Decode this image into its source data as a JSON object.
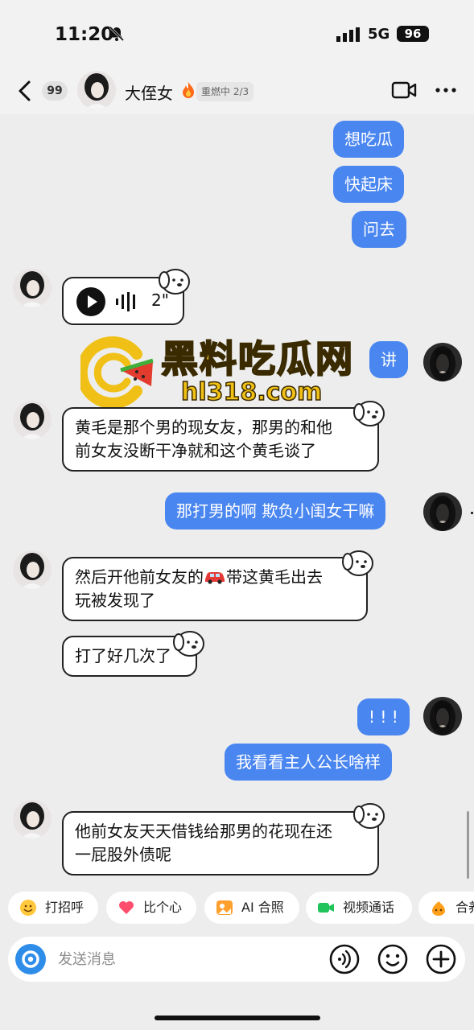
{
  "status": {
    "time": "11:20",
    "network": "5G",
    "battery": "96"
  },
  "header": {
    "unread": "99",
    "name": "大侄女",
    "streak": "重燃中 2/3"
  },
  "messages": {
    "m1": "想吃瓜",
    "m2": "快起床",
    "m3": "问去",
    "voice_duration": "2\"",
    "m4": "讲",
    "t1_line1": "黄毛是那个男的现女友，那男的和他",
    "t1_line2": "前女友没断干净就和这个黄毛谈了",
    "m5": "那打男的啊 欺负小闺女干嘛",
    "t2_line1a": "然后开他前女友的",
    "t2_line1b": "带这黄毛出去",
    "t2_line2": "玩被发现了",
    "t3": "打了好几次了",
    "m6": "! ! !",
    "m7": "我看看主人公长啥样",
    "t4_line1": "他前女友天天借钱给那男的花现在还",
    "t4_line2": "一屁股外债呢"
  },
  "watermark": {
    "title": "黑料吃瓜网",
    "url": "hl318.com"
  },
  "quick_actions": [
    "打招呼",
    "比个心",
    "AI 合照",
    "视频通话",
    "合养"
  ],
  "input": {
    "placeholder": "发送消息"
  }
}
